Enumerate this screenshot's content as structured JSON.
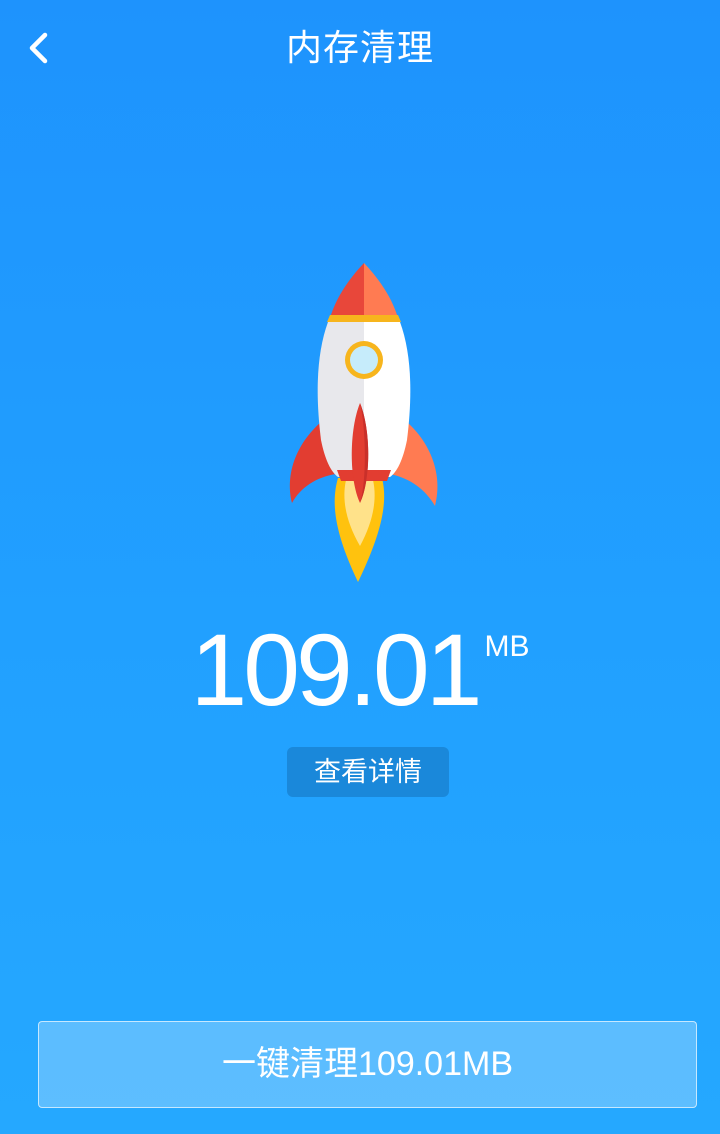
{
  "header": {
    "back_icon": "chevron-left-icon",
    "title": "内存清理"
  },
  "illustration": {
    "icon": "rocket-icon"
  },
  "memory": {
    "value": "109.01",
    "unit": "MB"
  },
  "details_button": {
    "label": "查看详情"
  },
  "clean_button": {
    "label": "一键清理109.01MB"
  },
  "colors": {
    "background_top": "#1E93FD",
    "background_bottom": "#25A8FF",
    "details_button": "#1A88DA",
    "text": "#FFFFFF",
    "rocket_red": "#E23D31",
    "rocket_orange": "#FF7B52",
    "rocket_yellow": "#FFC20E"
  }
}
